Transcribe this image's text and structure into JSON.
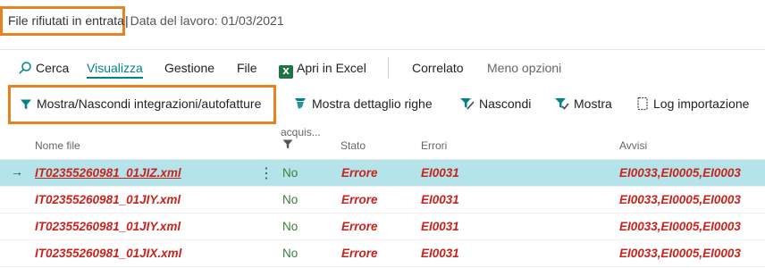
{
  "header": {
    "title": "File rifiutati in entrata",
    "separator": "|",
    "date_label": "Data del lavoro: 01/03/2021"
  },
  "action_bar": {
    "search": "Cerca",
    "view": "Visualizza",
    "manage": "Gestione",
    "file": "File",
    "excel_icon_text": "X",
    "excel": "Apri in Excel",
    "related": "Correlato",
    "fewer": "Meno opzioni"
  },
  "sub_actions": {
    "toggle": "Mostra/Nascondi integrazioni/autofatture",
    "detail": "Mostra dettaglio righe",
    "hide": "Nascondi",
    "show": "Mostra",
    "log": "Log importazione"
  },
  "columns": {
    "name": "Nome file",
    "acq": "acquis...",
    "status": "Stato",
    "errors": "Errori",
    "warnings": "Avvisi"
  },
  "rows": [
    {
      "file": "IT02355260981_01JIZ.xml",
      "acq": "No",
      "status": "Errore",
      "errors": "EI0031",
      "warnings": "EI0033,EI0005,EI0003"
    },
    {
      "file": "IT02355260981_01JIY.xml",
      "acq": "No",
      "status": "Errore",
      "errors": "EI0031",
      "warnings": "EI0033,EI0005,EI0003"
    },
    {
      "file": "IT02355260981_01JIY.xml",
      "acq": "No",
      "status": "Errore",
      "errors": "EI0031",
      "warnings": "EI0033,EI0005,EI0003"
    },
    {
      "file": "IT02355260981_01JIX.xml",
      "acq": "No",
      "status": "Errore",
      "errors": "EI0031",
      "warnings": "EI0033,EI0005,EI0003"
    }
  ],
  "icons": {
    "row_arrow": "→",
    "row_menu": "⋮"
  },
  "colors": {
    "accent": "#008489",
    "highlight": "#E8821E",
    "error": "#C8231D",
    "selected_row": "#b4e4ea"
  }
}
